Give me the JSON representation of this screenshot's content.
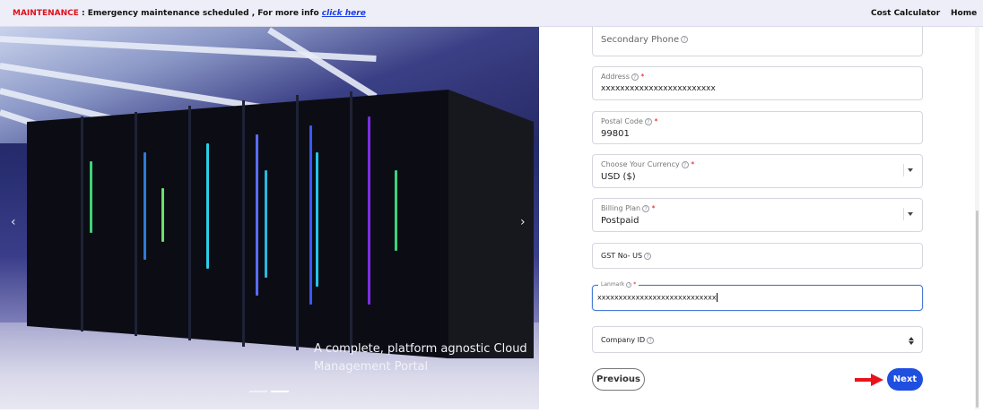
{
  "banner": {
    "tag": "MAINTENANCE",
    "message": " : Emergency maintenance scheduled , For more info ",
    "link": "click here",
    "nav": {
      "cost_calculator": "Cost Calculator",
      "home": "Home"
    }
  },
  "carousel": {
    "caption": "A complete, platform agnostic Cloud Management Portal",
    "prev_glyph": "‹",
    "next_glyph": "›",
    "active_slide": 2,
    "slide_count": 2
  },
  "form": {
    "secondary_phone": {
      "placeholder": "Secondary Phone"
    },
    "address": {
      "label": "Address",
      "value": "xxxxxxxxxxxxxxxxxxxxxxxx",
      "required": true
    },
    "postal_code": {
      "label": "Postal Code",
      "value": "99801",
      "required": true
    },
    "currency": {
      "label": "Choose Your Currency",
      "value": "USD ($)",
      "required": true
    },
    "billing_plan": {
      "label": "Billing Plan",
      "value": "Postpaid",
      "required": true
    },
    "gst": {
      "placeholder": "GST No- US"
    },
    "landmark": {
      "label": "Lanmark",
      "value": "xxxxxxxxxxxxxxxxxxxxxxxxxxxx",
      "required": true
    },
    "company_id": {
      "placeholder": "Company ID"
    },
    "help_glyph": "?",
    "required_mark": "*"
  },
  "buttons": {
    "previous": "Previous",
    "next": "Next"
  },
  "colors": {
    "accent": "#1f4fe0",
    "alert": "#e0101a",
    "link": "#1a3ee8"
  }
}
